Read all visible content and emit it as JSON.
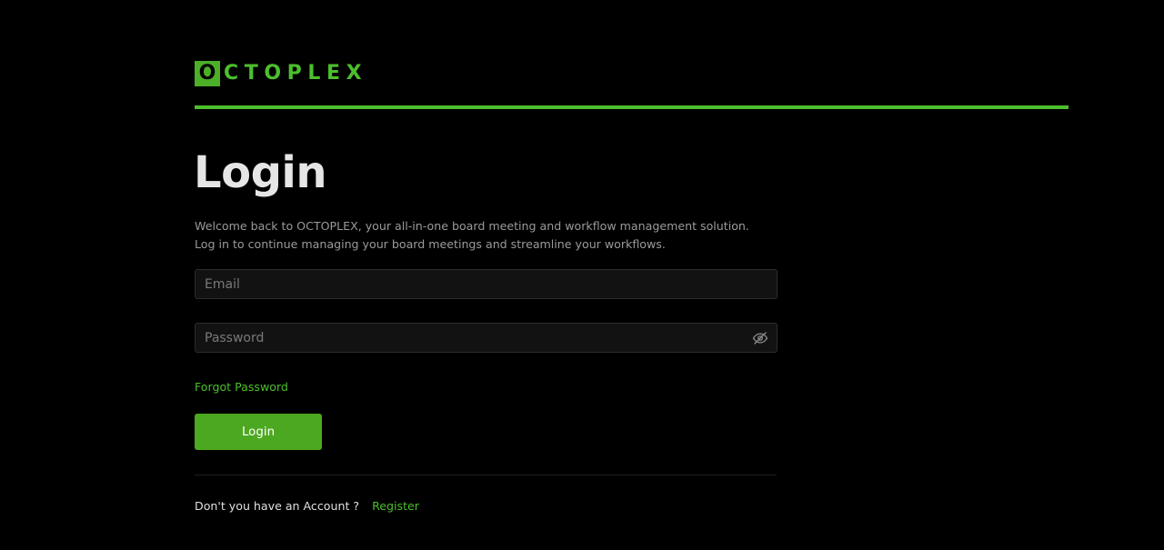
{
  "brand": {
    "logo_letter": "O",
    "logo_rest": "CTOPLEX",
    "color": "#4cbf2c"
  },
  "page": {
    "title": "Login",
    "subtitle_line1": "Welcome back to OCTOPLEX, your all-in-one board meeting and workflow management solution.",
    "subtitle_line2": "Log in to continue managing your board meetings and streamline your workflows."
  },
  "form": {
    "email_placeholder": "Email",
    "email_value": "",
    "password_placeholder": "Password",
    "password_value": "",
    "password_toggle_icon": "eye-slash-icon",
    "forgot_label": "Forgot Password",
    "login_label": "Login",
    "button_color": "#4ca820"
  },
  "footer": {
    "question": "Don't you have an Account ?",
    "register_label": "Register"
  }
}
